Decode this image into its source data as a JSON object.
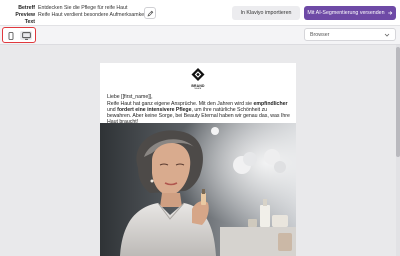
{
  "header": {
    "subject_label": "Betreff",
    "preview_label": "Preview Text",
    "subject_value": "Entdecken Sie die Pflege für reife Haut",
    "preview_value": "Reife Haut verdient besondere Aufmerksamkeit",
    "edit_icon": "pencil-icon",
    "import_label": "In Klaviyo importieren",
    "send_label": "Mit AI-Segmentierung versenden",
    "send_icon": "arrow-right-icon",
    "send_color": "#6e4aa6"
  },
  "toolbar": {
    "mobile_icon": "mobile-icon",
    "desktop_icon": "desktop-icon",
    "browser_select": "Browser",
    "toggle_border_color": "#e0393e"
  },
  "email": {
    "logo_text": "BRAND",
    "logo_subtext": "NAME",
    "greeting": "Liebe [[first_name]],",
    "paragraph": {
      "p1": "Reife Haut hat ganz eigene Ansprüche. Mit den Jahren wird sie ",
      "b1": "empfindlicher",
      "p2": " und ",
      "b2": "fordert eine intensivere Pflege",
      "p3": ", um ihre natürliche Schönheit zu bewahren. Aber keine Sorge, bei Beauty Eternal haben wir genau das, was Ihre Haut braucht!"
    },
    "image_subject": "mature-woman-applying-serum-photo"
  }
}
